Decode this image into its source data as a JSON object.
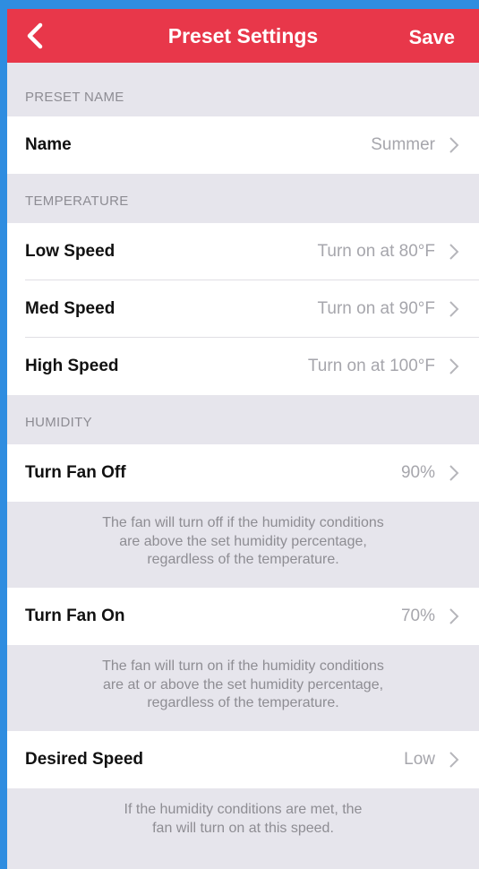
{
  "navbar": {
    "back_icon": "chevron-left-icon",
    "title": "Preset Settings",
    "save_label": "Save",
    "bg_color": "#e8374a"
  },
  "sections": {
    "preset_name": {
      "header": "PRESET NAME",
      "name_row": {
        "label": "Name",
        "value": "Summer"
      }
    },
    "temperature": {
      "header": "TEMPERATURE",
      "low": {
        "label": "Low Speed",
        "value": "Turn on at 80°F"
      },
      "med": {
        "label": "Med Speed",
        "value": "Turn on at 90°F"
      },
      "high": {
        "label": "High Speed",
        "value": "Turn on at 100°F"
      }
    },
    "humidity": {
      "header": "HUMIDITY",
      "fan_off": {
        "label": "Turn Fan Off",
        "value": "90%",
        "note_lines": [
          "The fan will turn off if the humidity conditions",
          "are above the set humidity percentage,",
          "regardless of the temperature."
        ]
      },
      "fan_on": {
        "label": "Turn Fan On",
        "value": "70%",
        "note_lines": [
          "The fan will turn on if the humidity conditions",
          "are at or above the set humidity percentage,",
          "regardless of the temperature."
        ]
      },
      "desired_speed": {
        "label": "Desired Speed",
        "value": "Low",
        "note_lines": [
          "If the humidity conditions are met, the",
          "fan will turn on at this speed."
        ]
      }
    }
  },
  "row_chevron_icon": "chevron-right-icon"
}
